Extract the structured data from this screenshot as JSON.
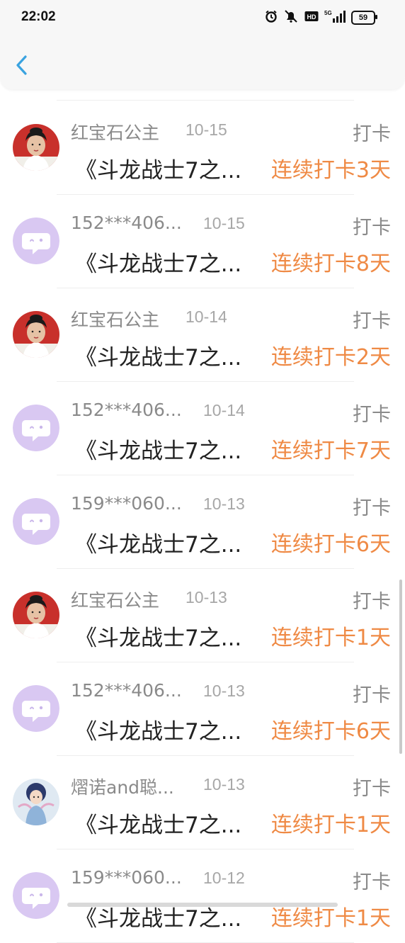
{
  "status_bar": {
    "time": "22:02",
    "network": "5G",
    "battery": "59",
    "icons": [
      "alarm-icon",
      "mute-bell-icon",
      "hd-icon",
      "signal-5g-icon",
      "battery-icon"
    ]
  },
  "nav": {
    "back_icon": "chevron-left-icon",
    "accent_color": "#3aa3e0"
  },
  "colors": {
    "streak": "#ef8a45",
    "meta": "#8a8a8a",
    "title": "#222222"
  },
  "items": [
    {
      "user": "红宝石公主",
      "date": "10-15",
      "type": "打卡",
      "title": "《斗龙战士7之...",
      "streak": "连续打卡3天",
      "avatar": "photo-woman"
    },
    {
      "user": "152***406...",
      "date": "10-15",
      "type": "打卡",
      "title": "《斗龙战士7之...",
      "streak": "连续打卡8天",
      "avatar": "default-chat"
    },
    {
      "user": "红宝石公主",
      "date": "10-14",
      "type": "打卡",
      "title": "《斗龙战士7之...",
      "streak": "连续打卡2天",
      "avatar": "photo-woman"
    },
    {
      "user": "152***406...",
      "date": "10-14",
      "type": "打卡",
      "title": "《斗龙战士7之...",
      "streak": "连续打卡7天",
      "avatar": "default-chat"
    },
    {
      "user": "159***060...",
      "date": "10-13",
      "type": "打卡",
      "title": "《斗龙战士7之...",
      "streak": "连续打卡6天",
      "avatar": "default-chat"
    },
    {
      "user": "红宝石公主",
      "date": "10-13",
      "type": "打卡",
      "title": "《斗龙战士7之...",
      "streak": "连续打卡1天",
      "avatar": "photo-woman"
    },
    {
      "user": "152***406...",
      "date": "10-13",
      "type": "打卡",
      "title": "《斗龙战士7之...",
      "streak": "连续打卡6天",
      "avatar": "default-chat"
    },
    {
      "user": "熠诺and聪...",
      "date": "10-13",
      "type": "打卡",
      "title": "《斗龙战士7之...",
      "streak": "连续打卡1天",
      "avatar": "photo-anime"
    },
    {
      "user": "159***060...",
      "date": "10-12",
      "type": "打卡",
      "title": "《斗龙战士7之...",
      "streak": "连续打卡1天",
      "avatar": "default-chat"
    }
  ]
}
